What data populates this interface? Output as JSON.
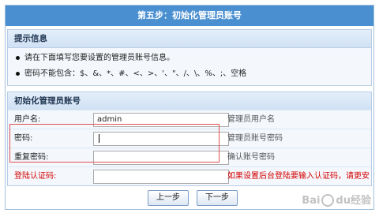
{
  "title": "第五步：初始化管理员账号",
  "tips": {
    "header": "提示信息",
    "items": [
      "请在下面填写您要设置的管理员账号信息。",
      "密码不能包含：$、&、*、#、<、>、'、\"、/、\\、%、;、空格"
    ]
  },
  "admin_section": {
    "header": "初始化管理员账号",
    "rows": [
      {
        "label": "用户名:",
        "value": "admin",
        "hint": "管理员用户名"
      },
      {
        "label": "密码:",
        "value": "",
        "hint": "管理员账号密码"
      },
      {
        "label": "重复密码:",
        "value": "",
        "hint": "确认账号密码"
      },
      {
        "label": "登陆认证码:",
        "value": "",
        "hint": "如果设置后台登陆要输入认证码，请更安全"
      }
    ]
  },
  "buttons": {
    "prev": "上一步",
    "next": "下一步"
  },
  "watermark": {
    "text_left": "Bai",
    "text_right": "经验",
    "sub": "du"
  }
}
